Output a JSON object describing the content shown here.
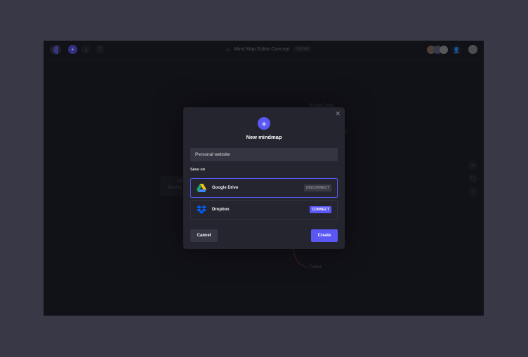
{
  "topbar": {
    "doc_title": "Mind Map Editor Concept",
    "status": "Saved"
  },
  "canvas": {
    "nodes": [
      "Google Drive",
      "ect",
      "Sir",
      "Mind M",
      "Twitter"
    ]
  },
  "modal": {
    "title": "New mindmap",
    "input_value": "Personal website",
    "save_on_label": "Save on",
    "options": [
      {
        "name": "Google Drive",
        "action": "DISCONNECT"
      },
      {
        "name": "Dropbox",
        "action": "CONNECT"
      }
    ],
    "cancel": "Cancel",
    "create": "Create"
  },
  "colors": {
    "accent": "#5b57f5"
  }
}
